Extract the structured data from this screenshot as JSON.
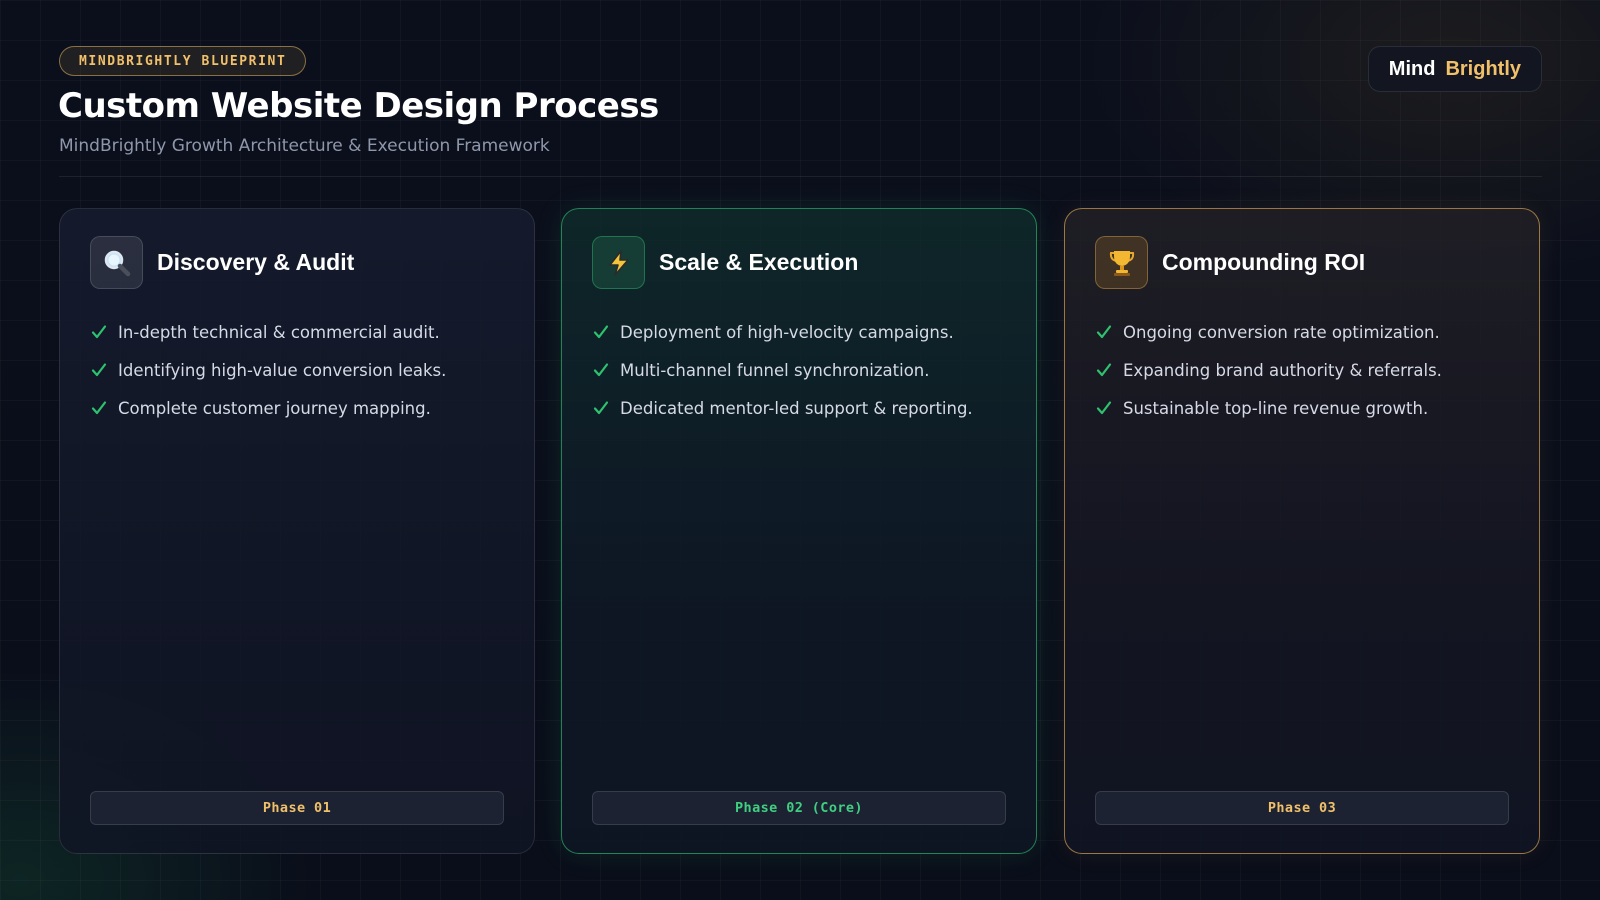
{
  "header": {
    "badge": "MINDBRIGHTLY BLUEPRINT",
    "title": "Custom Website Design Process",
    "subtitle": "MindBrightly Growth Architecture & Execution Framework"
  },
  "brand": {
    "part1": "Mind",
    "part2": "Brightly"
  },
  "colors": {
    "accent_gold": "#f1c06a",
    "accent_green": "#3fcf82",
    "background": "#0a0e1a"
  },
  "cards": [
    {
      "icon": "magnifying-glass-icon",
      "title": "Discovery & Audit",
      "bullets": [
        "In-depth technical & commercial audit.",
        "Identifying high-value conversion leaks.",
        "Complete customer journey mapping."
      ],
      "phase": "Phase 01"
    },
    {
      "icon": "lightning-icon",
      "title": "Scale & Execution",
      "bullets": [
        "Deployment of high-velocity campaigns.",
        "Multi-channel funnel synchronization.",
        "Dedicated mentor-led support & reporting."
      ],
      "phase": "Phase 02 (Core)"
    },
    {
      "icon": "trophy-icon",
      "title": "Compounding ROI",
      "bullets": [
        "Ongoing conversion rate optimization.",
        "Expanding brand authority & referrals.",
        "Sustainable top-line revenue growth."
      ],
      "phase": "Phase 03"
    }
  ]
}
